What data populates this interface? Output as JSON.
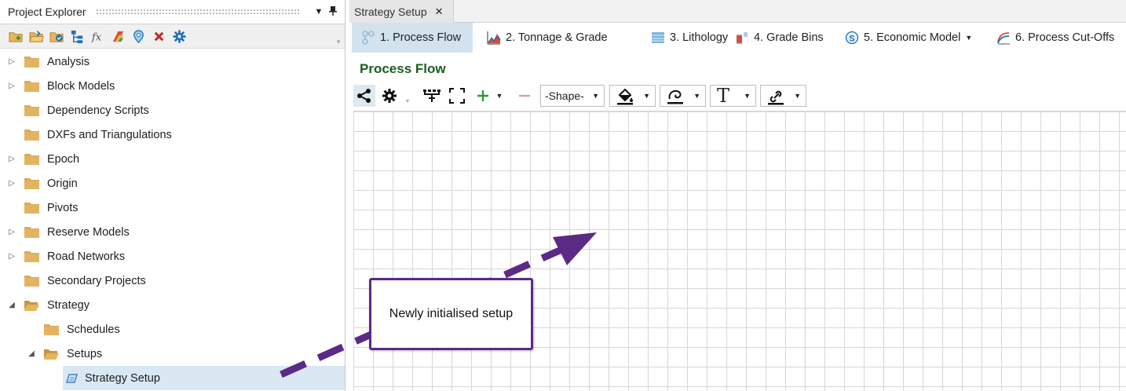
{
  "left_panel": {
    "title": "Project Explorer",
    "dropdown_glyph": "▼",
    "pin_glyph": "📌",
    "toolbar_icons": [
      "new-folder-icon",
      "open-folder-icon",
      "folder-check-icon",
      "tree-view-icon",
      "function-icon",
      "layers-icon",
      "map-pin-icon",
      "delete-icon",
      "settings-icon"
    ],
    "toolbar_colors": {
      "folder": "#e7b55a",
      "delete": "#cc1f1f",
      "accent": "#1f6fb5"
    },
    "tree": [
      {
        "label": "Analysis",
        "expandable": true,
        "expanded": false,
        "level": 0
      },
      {
        "label": "Block Models",
        "expandable": true,
        "expanded": false,
        "level": 0
      },
      {
        "label": "Dependency Scripts",
        "expandable": false,
        "level": 0
      },
      {
        "label": "DXFs and Triangulations",
        "expandable": false,
        "level": 0
      },
      {
        "label": "Epoch",
        "expandable": true,
        "expanded": false,
        "level": 0
      },
      {
        "label": "Origin",
        "expandable": true,
        "expanded": false,
        "level": 0
      },
      {
        "label": "Pivots",
        "expandable": false,
        "level": 0
      },
      {
        "label": "Reserve Models",
        "expandable": true,
        "expanded": false,
        "level": 0
      },
      {
        "label": "Road Networks",
        "expandable": true,
        "expanded": false,
        "level": 0
      },
      {
        "label": "Secondary Projects",
        "expandable": false,
        "level": 0
      },
      {
        "label": "Strategy",
        "expandable": true,
        "expanded": true,
        "level": 0
      },
      {
        "label": "Schedules",
        "expandable": false,
        "level": 1
      },
      {
        "label": "Setups",
        "expandable": true,
        "expanded": true,
        "level": 1
      },
      {
        "label": "Strategy Setup",
        "expandable": false,
        "level": 2,
        "selected": true
      }
    ]
  },
  "document_tab": {
    "label": "Strategy Setup",
    "close_glyph": "✕"
  },
  "nav_tabs": [
    {
      "label": "1. Process Flow",
      "icon": "process-flow-icon",
      "active": true
    },
    {
      "label": "2. Tonnage & Grade",
      "icon": "tonnage-chart-icon",
      "active": false
    },
    {
      "label": "3. Lithology",
      "icon": "lithology-icon",
      "active": false
    },
    {
      "label": "4. Grade Bins",
      "icon": "grade-bins-icon",
      "active": false
    },
    {
      "label": "5. Economic Model",
      "icon": "economic-model-icon",
      "active": false,
      "dropdown": true
    },
    {
      "label": "6. Process Cut-Offs",
      "icon": "cutoff-curve-icon",
      "active": false
    }
  ],
  "section_title": "Process Flow",
  "draw_toolbar": {
    "shape_select": "-Shape-",
    "caret": "▼",
    "tools": [
      "share-icon",
      "settings-icon",
      "hierarchy-icon",
      "fit-to-screen-icon",
      "add-icon",
      "remove-icon",
      "fill-icon",
      "line-color-icon",
      "text-icon",
      "link-icon"
    ],
    "text_glyph": "T"
  },
  "callout": {
    "text": "Newly initialised setup",
    "border_color": "#5b2a86"
  },
  "colors": {
    "section_title": "#1b5e20",
    "active_tab_bg": "#d2e3ef",
    "selected_row_bg": "#d9e8f3",
    "arrow": "#5b2a86"
  }
}
